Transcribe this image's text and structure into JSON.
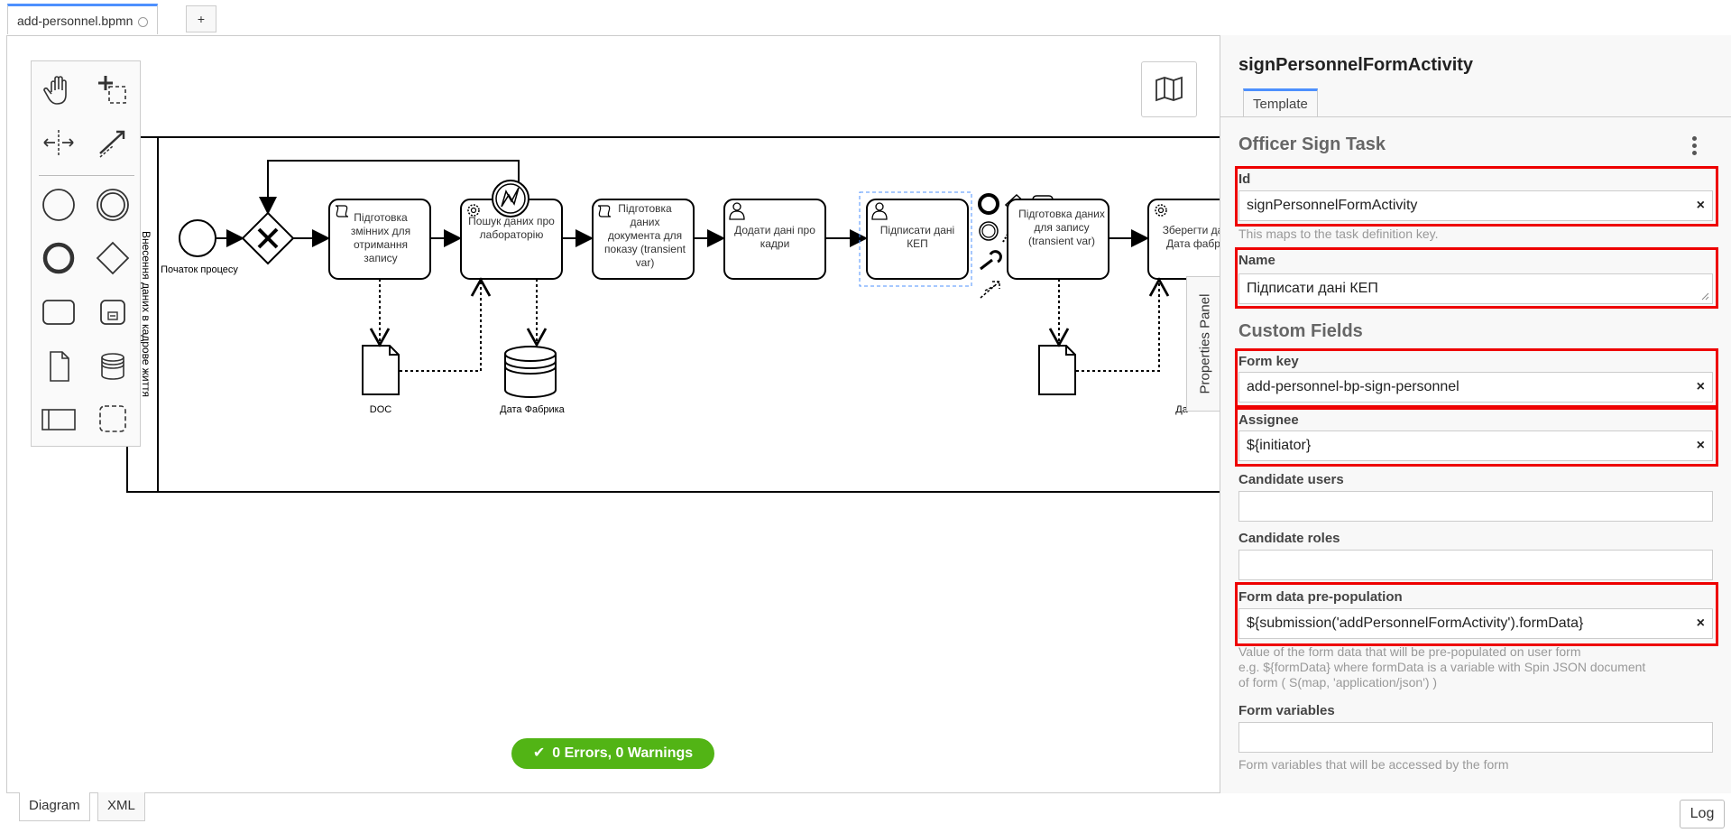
{
  "tabs": {
    "file_tab": "add-personnel.bpmn",
    "add_tab": "+"
  },
  "bottom_tabs": {
    "diagram": "Diagram",
    "xml": "XML",
    "log": "Log"
  },
  "status": {
    "text": "0 Errors, 0 Warnings",
    "color": "#52b415"
  },
  "properties_toggle": "Properties Panel",
  "diagram": {
    "lane_label": "Внесення даних в кадрове життя",
    "start_event": "Початок процесу",
    "tasks": {
      "prepare_vars": "Підготовка змінних для отримання запису",
      "search_lab": "Пошук даних про лабораторію",
      "prepare_doc": "Підготовка даних документа для показу (transient var)",
      "add_personnel": "Додати дані про кадри",
      "sign_kep": "Підписати дані КЕП",
      "prepare_record": "Підготовка даних для запису (transient var)",
      "save_factory": "Зберегти дані в Дата фабрику"
    },
    "artifacts": {
      "doc": "DOC",
      "data_factory": "Дата Фабрика",
      "data_factory_2": "Да"
    }
  },
  "properties": {
    "element_id_title": "signPersonnelFormActivity",
    "template_tab": "Template",
    "group_title": "Officer Sign Task",
    "id": {
      "label": "Id",
      "value": "signPersonnelFormActivity",
      "hint": "This maps to the task definition key."
    },
    "name": {
      "label": "Name",
      "value": "Підписати дані КЕП"
    },
    "custom_fields_title": "Custom Fields",
    "form_key": {
      "label": "Form key",
      "value": "add-personnel-bp-sign-personnel"
    },
    "assignee": {
      "label": "Assignee",
      "value": "${initiator}"
    },
    "candidate_users": {
      "label": "Candidate users",
      "value": ""
    },
    "candidate_roles": {
      "label": "Candidate roles",
      "value": ""
    },
    "form_data": {
      "label": "Form data pre-population",
      "value": "${submission('addPersonnelFormActivity').formData}",
      "hint_1": "Value of the form data that will be pre-populated on user form",
      "hint_2": "e.g. ${formData} where formData is a variable with Spin JSON document",
      "hint_3": "of form ( S(map, 'application/json') )"
    },
    "form_variables": {
      "label": "Form variables",
      "value": "",
      "hint": "Form variables that will be accessed by the form"
    },
    "clear_symbol": "×"
  },
  "colors": {
    "accent": "#4d90fe",
    "highlight": "#e00000"
  }
}
